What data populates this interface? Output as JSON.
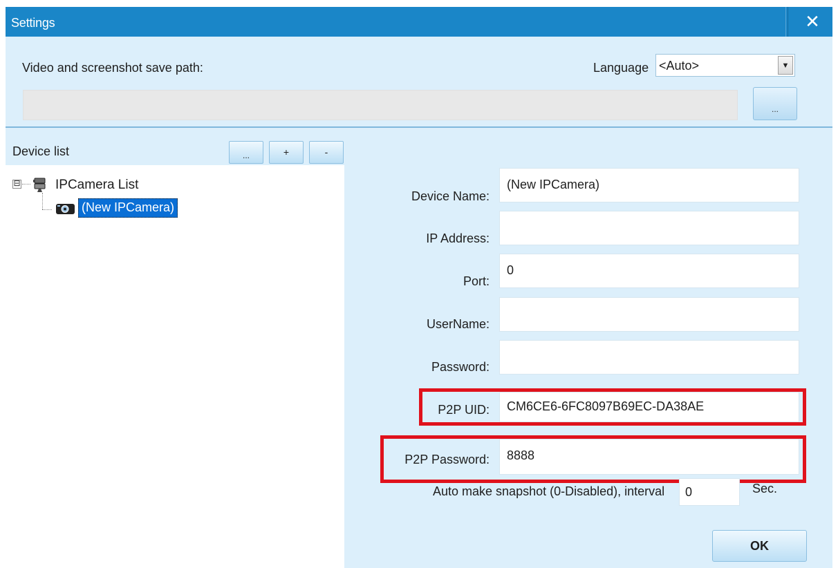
{
  "window": {
    "title": "Settings"
  },
  "top": {
    "path_label": "Video and screenshot save path:",
    "path_value": "",
    "browse_label": "...",
    "language_label": "Language",
    "language_value": "<Auto>"
  },
  "device_list": {
    "label": "Device list",
    "buttons": [
      "...",
      "+",
      "-"
    ],
    "tree": {
      "expander": "⊟",
      "root_label": "IPCamera List",
      "child_label": "(New IPCamera)"
    }
  },
  "form": {
    "fields": [
      {
        "label": "Device Name:",
        "value": "(New IPCamera)"
      },
      {
        "label": "IP Address:",
        "value": ""
      },
      {
        "label": "Port:",
        "value": "0"
      },
      {
        "label": "UserName:",
        "value": ""
      },
      {
        "label": "Password:",
        "value": ""
      },
      {
        "label": "P2P UID:",
        "value": "CM6CE6-6FC8097B69EC-DA38AE"
      },
      {
        "label": "P2P Password:",
        "value": "8888"
      }
    ],
    "snapshot_label": "Auto make snapshot (0-Disabled), interval",
    "snapshot_value": "0",
    "snapshot_unit": "Sec.",
    "ok_label": "OK"
  },
  "colors": {
    "titlebar": "#1a86c8",
    "panel": "#dceffb",
    "highlight": "#e0121c",
    "selection": "#0a6fd6"
  },
  "icons": {
    "close": "close-icon",
    "tree_root": "cameras-icon",
    "tree_child": "ipcamera-icon",
    "dropdown": "dropdown-arrow-icon"
  }
}
